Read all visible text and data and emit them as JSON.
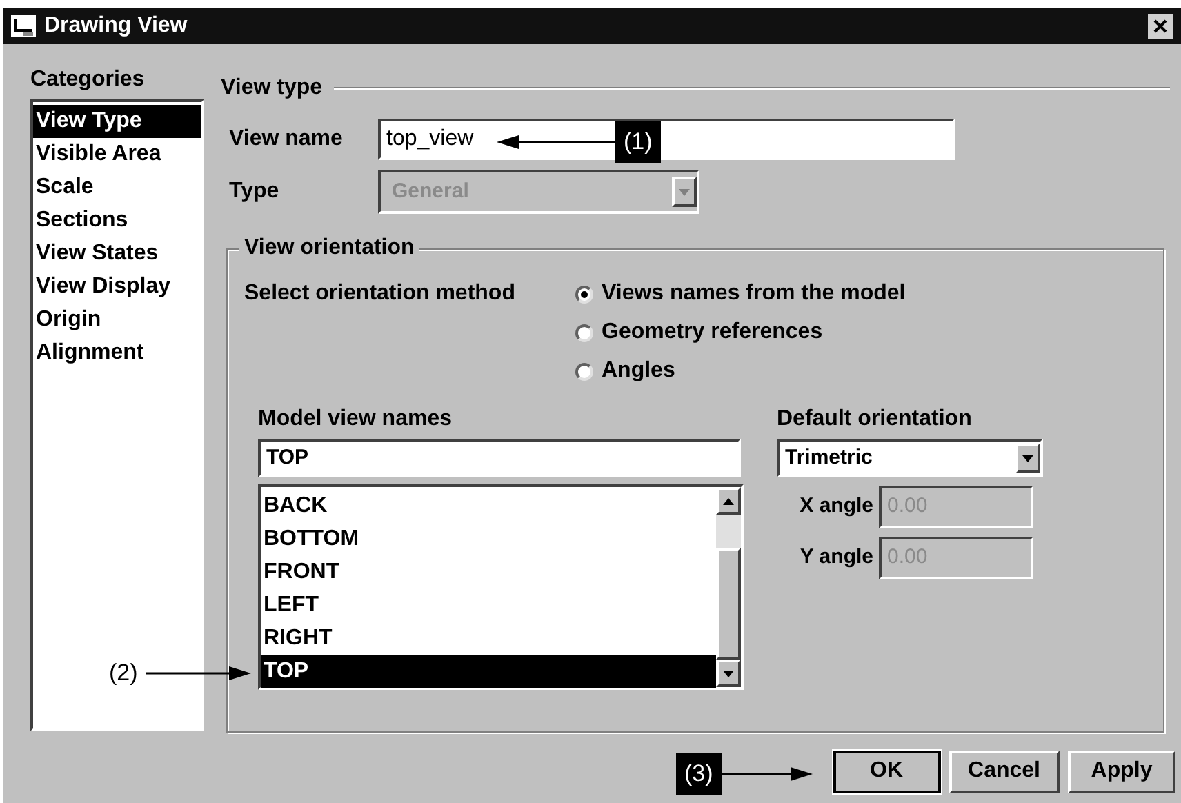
{
  "window": {
    "title": "Drawing View"
  },
  "categories": {
    "title": "Categories",
    "items": [
      {
        "label": "View Type",
        "selected": true
      },
      {
        "label": "Visible Area",
        "selected": false
      },
      {
        "label": "Scale",
        "selected": false
      },
      {
        "label": "Sections",
        "selected": false
      },
      {
        "label": "View States",
        "selected": false
      },
      {
        "label": "View Display",
        "selected": false
      },
      {
        "label": "Origin",
        "selected": false
      },
      {
        "label": "Alignment",
        "selected": false
      }
    ]
  },
  "view_type": {
    "title": "View type",
    "view_name": {
      "label": "View name",
      "value": "top_view"
    },
    "type": {
      "label": "Type",
      "value": "General",
      "disabled": true
    }
  },
  "view_orientation": {
    "title": "View orientation",
    "method_label": "Select orientation method",
    "methods": [
      {
        "label": "Views names from the model",
        "selected": true
      },
      {
        "label": "Geometry references",
        "selected": false
      },
      {
        "label": "Angles",
        "selected": false
      }
    ],
    "model_view_names": {
      "label": "Model view names",
      "value": "TOP",
      "items": [
        {
          "label": "BACK",
          "selected": false
        },
        {
          "label": "BOTTOM",
          "selected": false
        },
        {
          "label": "FRONT",
          "selected": false
        },
        {
          "label": "LEFT",
          "selected": false
        },
        {
          "label": "RIGHT",
          "selected": false
        },
        {
          "label": "TOP",
          "selected": true
        }
      ]
    },
    "default_orientation": {
      "label": "Default orientation",
      "value": "Trimetric",
      "x_angle": {
        "label": "X angle",
        "value": "0.00",
        "disabled": true
      },
      "y_angle": {
        "label": "Y angle",
        "value": "0.00",
        "disabled": true
      }
    }
  },
  "buttons": [
    {
      "label": "OK"
    },
    {
      "label": "Cancel"
    },
    {
      "label": "Apply"
    }
  ],
  "callouts": [
    {
      "label": "(1)",
      "kind": "dark"
    },
    {
      "label": "(2)",
      "kind": "light"
    },
    {
      "label": "(3)",
      "kind": "dark"
    }
  ]
}
